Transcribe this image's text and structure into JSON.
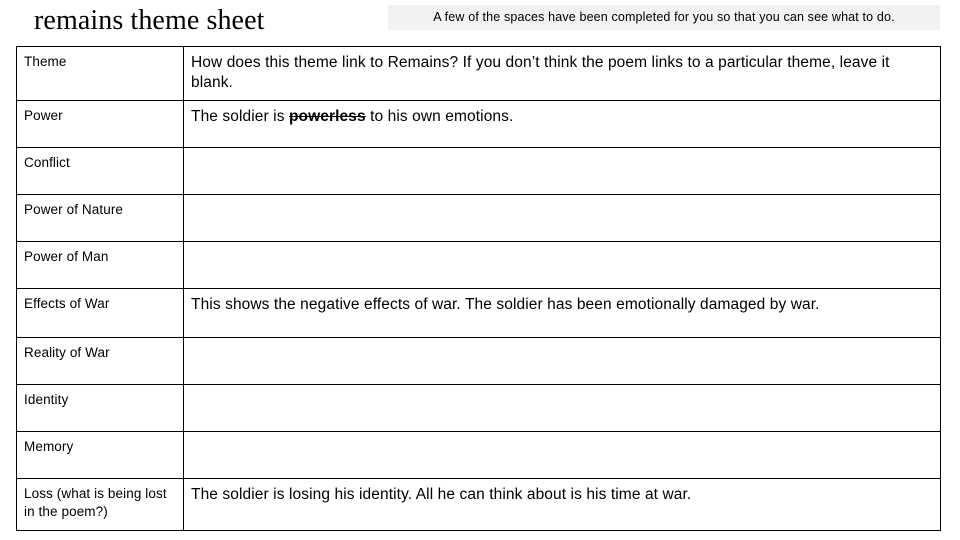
{
  "slide": {
    "title": "remains theme sheet",
    "note_banner": "A few of the spaces have been completed for you so that you can see what to do.",
    "note_banner_bg": "#f2f2f2",
    "background": "#ffffff",
    "border_color": "#000000"
  },
  "table": {
    "columns": [
      "Theme",
      "How does this theme link to Remains? If you don’t think the poem links to a particular theme, leave it blank."
    ],
    "rows": [
      {
        "theme": "Theme",
        "answer_pre": "How does this theme link to Remains? If you don’t think the poem links to a particular theme, leave it blank.",
        "answer_emphasis": "",
        "answer_post": ""
      },
      {
        "theme": "Power",
        "answer_pre": "The soldier is ",
        "answer_emphasis": "powerless",
        "answer_post": " to his own emotions."
      },
      {
        "theme": "Conflict",
        "answer_pre": "",
        "answer_emphasis": "",
        "answer_post": ""
      },
      {
        "theme": "Power of Nature",
        "answer_pre": "",
        "answer_emphasis": "",
        "answer_post": ""
      },
      {
        "theme": "Power of Man",
        "answer_pre": "",
        "answer_emphasis": "",
        "answer_post": ""
      },
      {
        "theme": "Effects of War",
        "answer_pre": "This shows the negative effects of war.  The soldier has been emotionally damaged by war.",
        "answer_emphasis": "",
        "answer_post": ""
      },
      {
        "theme": "Reality of War",
        "answer_pre": "",
        "answer_emphasis": "",
        "answer_post": ""
      },
      {
        "theme": "Identity",
        "answer_pre": "",
        "answer_emphasis": "",
        "answer_post": ""
      },
      {
        "theme": "Memory",
        "answer_pre": "",
        "answer_emphasis": "",
        "answer_post": ""
      },
      {
        "theme": "Loss (what is being lost in the poem?)",
        "answer_pre": "The soldier is losing his identity. All he can think about is his time at war.",
        "answer_emphasis": "",
        "answer_post": ""
      }
    ]
  }
}
